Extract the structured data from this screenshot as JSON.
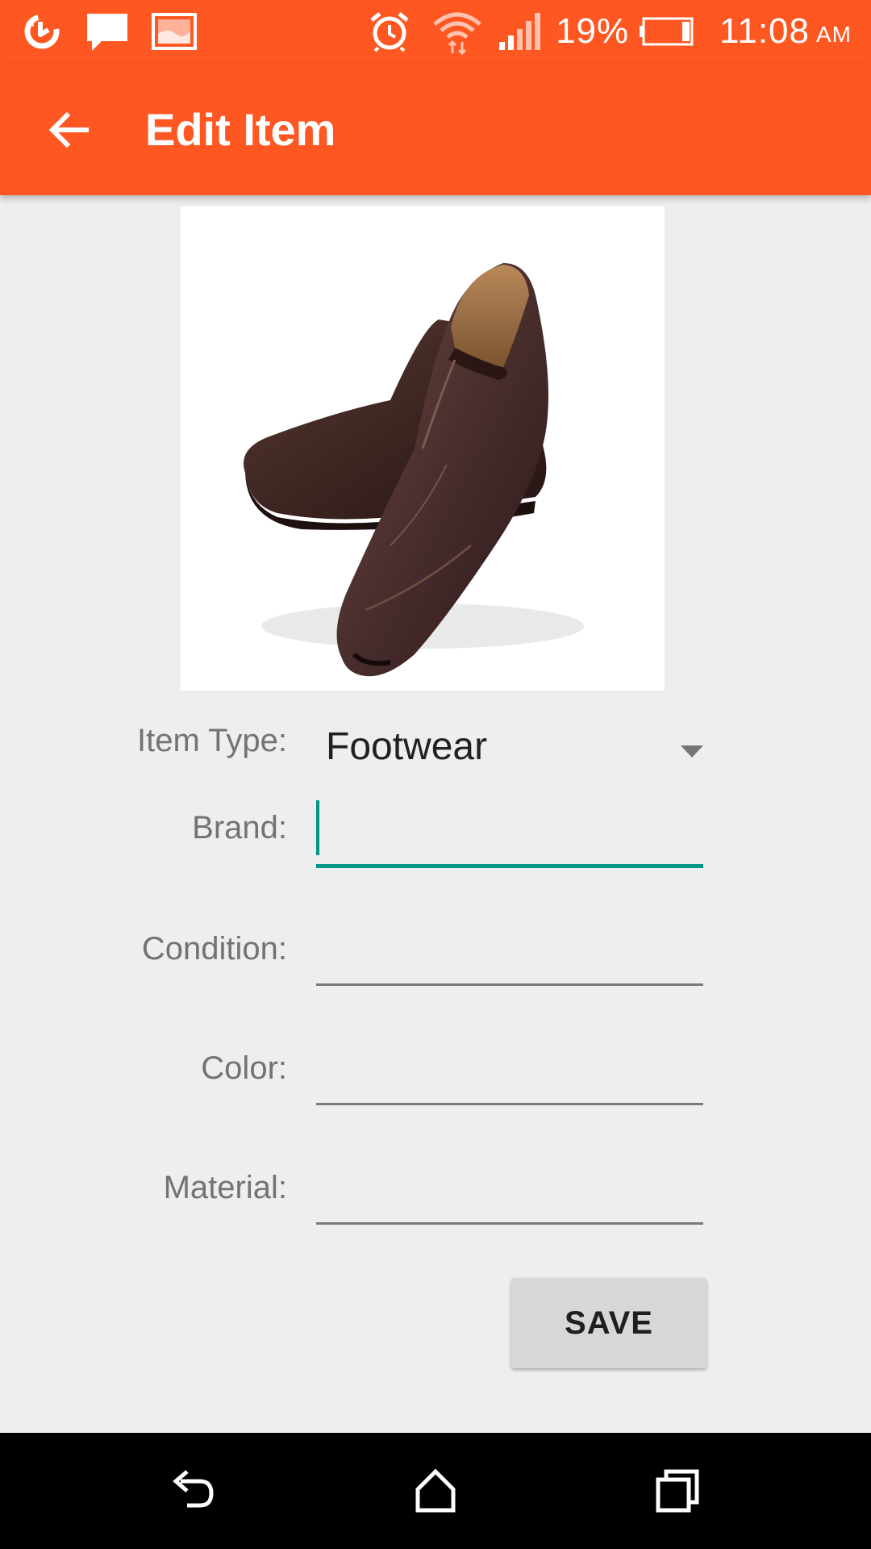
{
  "status_bar": {
    "left_icons": [
      "sync-icon",
      "message-icon",
      "gallery-icon"
    ],
    "right_icons": [
      "alarm-icon",
      "wifi-icon",
      "signal-icon",
      "battery-icon"
    ],
    "battery_percent": "19%",
    "battery_level": 0.19,
    "time": "11:08",
    "ampm": "AM"
  },
  "toolbar": {
    "back_icon": "back-arrow-icon",
    "title": "Edit Item"
  },
  "form": {
    "item_type": {
      "label": "Item Type:",
      "value": "Footwear"
    },
    "brand": {
      "label": "Brand:",
      "value": ""
    },
    "condition": {
      "label": "Condition:",
      "value": ""
    },
    "color": {
      "label": "Color:",
      "value": ""
    },
    "material": {
      "label": "Material:",
      "value": ""
    },
    "save_label": "SAVE"
  },
  "nav_bar": {
    "icons": [
      "nav-back-icon",
      "nav-home-icon",
      "nav-recents-icon"
    ]
  },
  "colors": {
    "primary": "#ff5722",
    "accent": "#009688",
    "background": "#eeeeee"
  }
}
